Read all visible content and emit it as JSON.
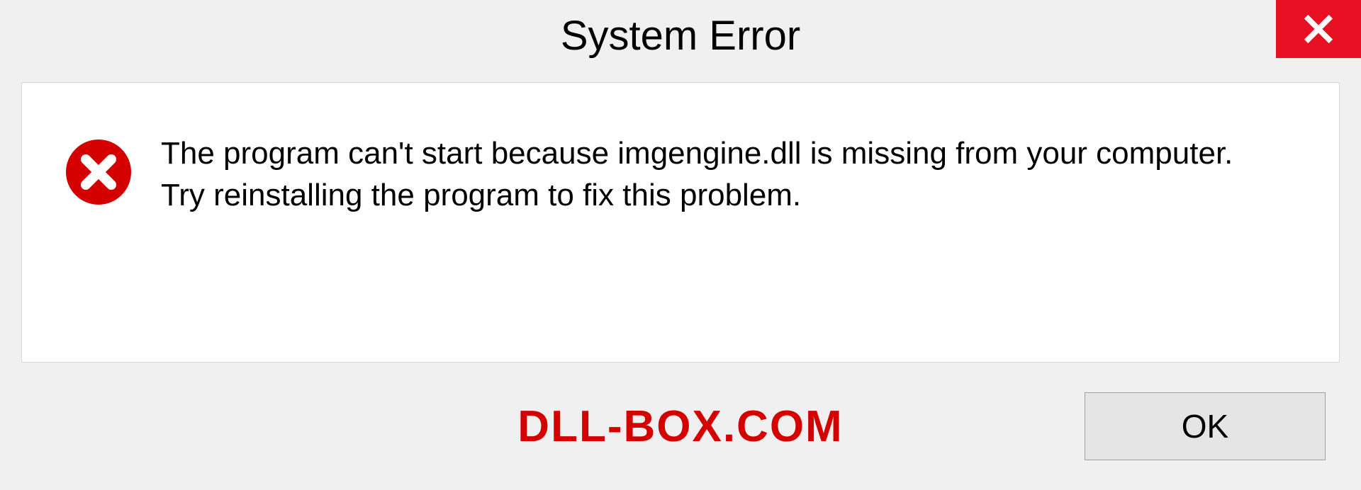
{
  "dialog": {
    "title": "System Error",
    "message": "The program can't start because imgengine.dll is missing from your computer. Try reinstalling the program to fix this problem.",
    "ok_label": "OK",
    "watermark": "DLL-BOX.COM"
  }
}
